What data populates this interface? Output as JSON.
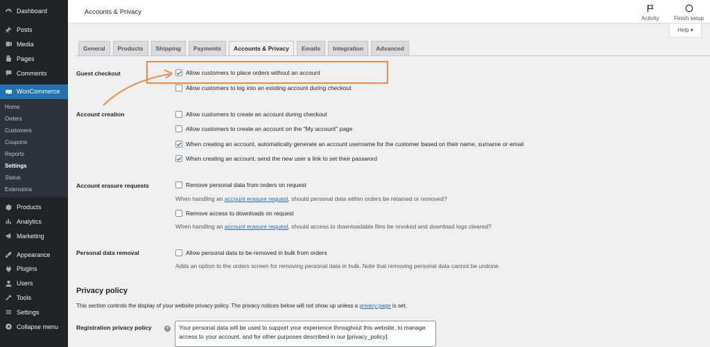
{
  "sidebar": {
    "top_items": [
      {
        "label": "Dashboard",
        "icon": "dashboard-icon"
      },
      {
        "label": "Posts",
        "icon": "pin-icon"
      },
      {
        "label": "Media",
        "icon": "media-icon"
      },
      {
        "label": "Pages",
        "icon": "pages-icon"
      },
      {
        "label": "Comments",
        "icon": "comments-icon"
      }
    ],
    "woocommerce_label": "WooCommerce",
    "submenu": [
      "Home",
      "Orders",
      "Customers",
      "Coupons",
      "Reports",
      "Settings",
      "Status",
      "Extensions"
    ],
    "submenu_current": "Settings",
    "bottom_items": [
      {
        "label": "Products",
        "icon": "products-icon"
      },
      {
        "label": "Analytics",
        "icon": "analytics-icon"
      },
      {
        "label": "Marketing",
        "icon": "marketing-icon"
      },
      {
        "label": "Appearance",
        "icon": "appearance-icon"
      },
      {
        "label": "Plugins",
        "icon": "plugins-icon"
      },
      {
        "label": "Users",
        "icon": "users-icon"
      },
      {
        "label": "Tools",
        "icon": "tools-icon"
      },
      {
        "label": "Settings",
        "icon": "settings-icon"
      },
      {
        "label": "Collapse menu",
        "icon": "collapse-icon"
      }
    ]
  },
  "header": {
    "title": "Accounts & Privacy",
    "activity_label": "Activity",
    "finish_setup_label": "Finish setup",
    "help_label": "Help ▾"
  },
  "tabs": [
    "General",
    "Products",
    "Shipping",
    "Payments",
    "Accounts & Privacy",
    "Emails",
    "Integration",
    "Advanced"
  ],
  "active_tab": "Accounts & Privacy",
  "guest_checkout": {
    "label": "Guest checkout",
    "options": [
      {
        "label": "Allow customers to place orders without an account",
        "checked": true
      },
      {
        "label": "Allow customers to log into an existing account during checkout",
        "checked": false
      }
    ]
  },
  "account_creation": {
    "label": "Account creation",
    "options": [
      {
        "label": "Allow customers to create an account during checkout",
        "checked": false
      },
      {
        "label": "Allow customers to create an account on the \"My account\" page",
        "checked": false
      },
      {
        "label": "When creating an account, automatically generate an account username for the customer based on their name, surname or email",
        "checked": true
      },
      {
        "label": "When creating an account, send the new user a link to set their password",
        "checked": true
      }
    ]
  },
  "erasure": {
    "label": "Account erasure requests",
    "option1": {
      "label": "Remove personal data from orders on request",
      "checked": false
    },
    "desc1_pre": "When handling an ",
    "desc1_link": "account erasure request",
    "desc1_post": ", should personal data within orders be retained or removed?",
    "option2": {
      "label": "Remove access to downloads on request",
      "checked": false
    },
    "desc2_pre": "When handling an ",
    "desc2_link": "account erasure request",
    "desc2_post": ", should access to downloadable files be revoked and download logs cleared?"
  },
  "data_removal": {
    "label": "Personal data removal",
    "option": {
      "label": "Allow personal data to be removed in bulk from orders",
      "checked": false
    },
    "desc": "Adds an option to the orders screen for removing personal data in bulk. Note that removing personal data cannot be undone."
  },
  "privacy": {
    "heading": "Privacy policy",
    "desc_pre": "This section controls the display of your website privacy policy. The privacy notices below will not show up unless a ",
    "desc_link": "privacy page",
    "desc_post": " is set.",
    "registration_label": "Registration privacy policy",
    "registration_text": "Your personal data will be used to support your experience throughout this website, to manage access to your account, and for other purposes described in our [privacy_policy]."
  },
  "colors": {
    "accent": "#2271b1",
    "sidebar_bg": "#1d2327",
    "annotation": "#f08c42"
  }
}
